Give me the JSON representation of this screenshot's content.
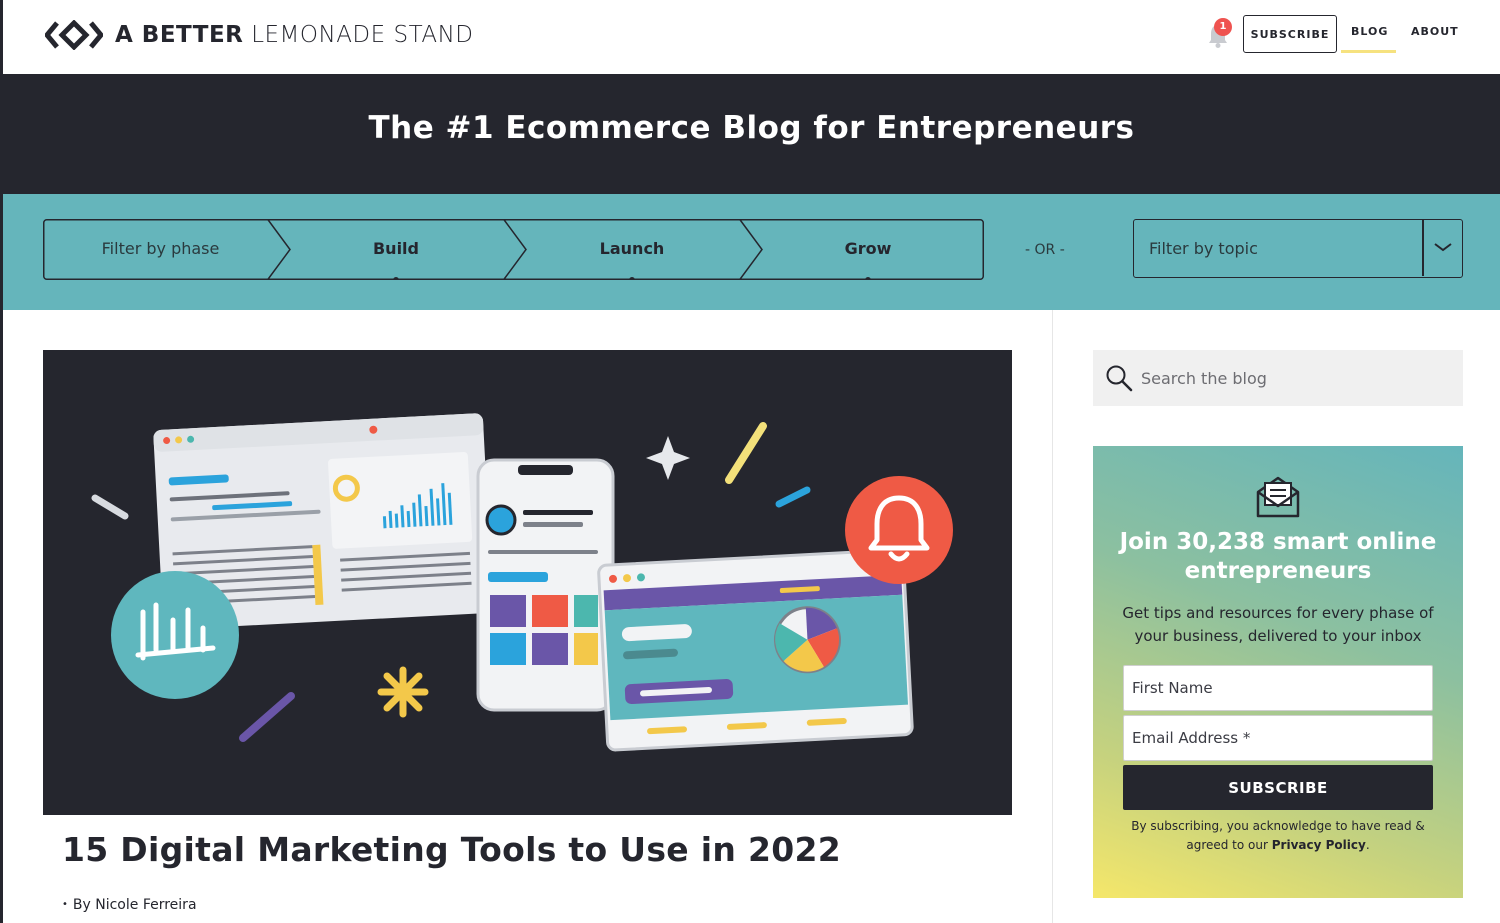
{
  "header": {
    "logo": {
      "bold": "A BETTER",
      "light": "LEMONADE STAND"
    },
    "notification_count": "1",
    "subscribe_label": "SUBSCRIBE",
    "nav": {
      "blog": "BLOG",
      "about": "ABOUT"
    }
  },
  "hero": {
    "title": "The #1 Ecommerce Blog for Entrepreneurs"
  },
  "filters": {
    "phase_placeholder": "Filter by phase",
    "phases": [
      "Build",
      "Launch",
      "Grow"
    ],
    "or": "- OR -",
    "topic_placeholder": "Filter by topic"
  },
  "post": {
    "title": "15 Digital Marketing Tools to Use in 2022",
    "byline": "By Nicole Ferreira"
  },
  "sidebar": {
    "search_placeholder": "Search the blog",
    "signup": {
      "title": "Join 30,238 smart online entrepreneurs",
      "text": "Get tips and resources for every phase of your business, delivered to your inbox",
      "first_name_placeholder": "First Name",
      "email_placeholder": "Email Address *",
      "button": "SUBSCRIBE",
      "legal_prefix": "By subscribing, you acknowledge to have read & agreed to our",
      "legal_link": "Privacy Policy",
      "legal_suffix": "."
    }
  },
  "colors": {
    "dark": "#25262e",
    "teal": "#65b5bb",
    "yellow": "#f6e27f",
    "red": "#ef5350"
  }
}
